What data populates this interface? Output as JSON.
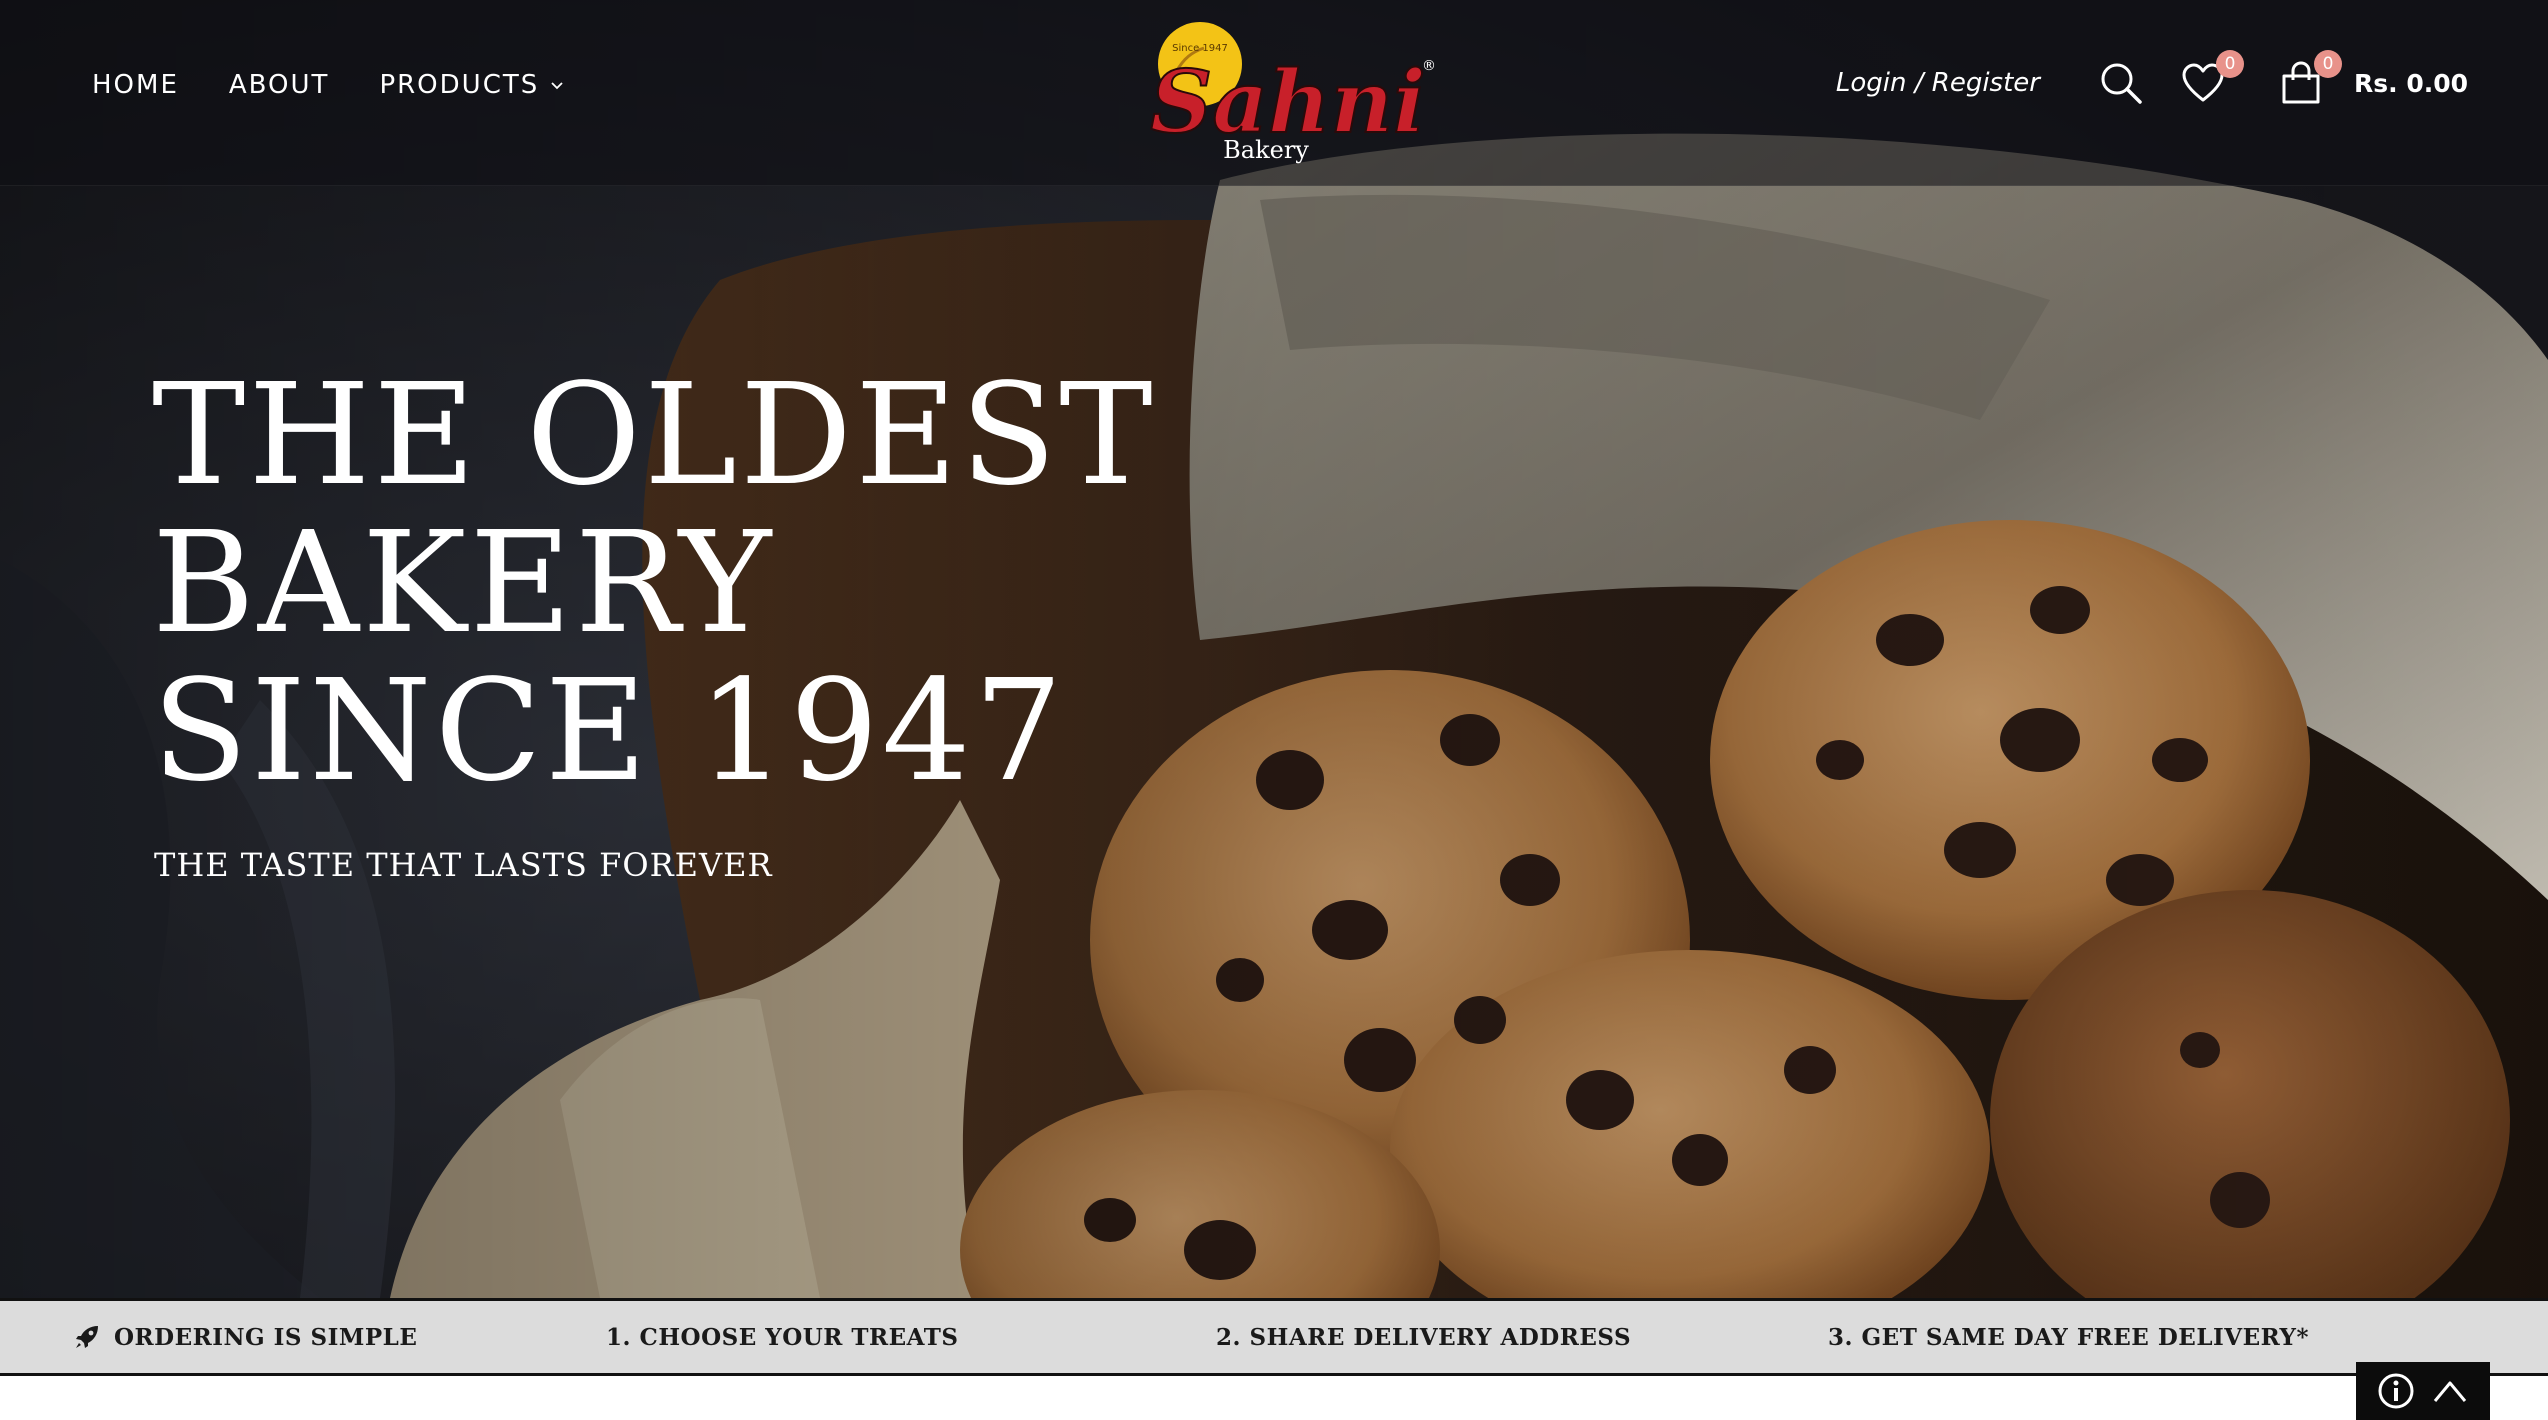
{
  "header": {
    "nav": [
      {
        "label": "HOME"
      },
      {
        "label": "ABOUT"
      },
      {
        "label": "PRODUCTS"
      }
    ],
    "logo": {
      "badge_text": "Since 1947",
      "name": "Sahni",
      "sub": "Bakery",
      "mark": "®"
    },
    "login_label": "Login / Register",
    "wishlist_count": "0",
    "cart_count": "0",
    "cart_total": "Rs. 0.00",
    "icons": [
      "search-icon",
      "heart-icon",
      "shopping-bag-icon",
      "chevron-down-icon"
    ]
  },
  "hero": {
    "headline": [
      "THE OLDEST",
      "BAKERY",
      "SINCE 1947"
    ],
    "tagline": "THE TASTE THAT LASTS FOREVER"
  },
  "strip": {
    "title": "ORDERING IS SIMPLE",
    "steps": [
      "1. CHOOSE YOUR TREATS",
      "2. SHARE DELIVERY ADDRESS",
      "3. GET SAME DAY FREE DELIVERY*"
    ]
  },
  "widget": {
    "icons": [
      "info-icon",
      "chevron-up-icon"
    ]
  },
  "colors": {
    "brand_red": "#c8202a",
    "logo_yellow": "#f3c316",
    "badge_pink": "#e8928a",
    "strip_bg": "#dcdcdc"
  }
}
